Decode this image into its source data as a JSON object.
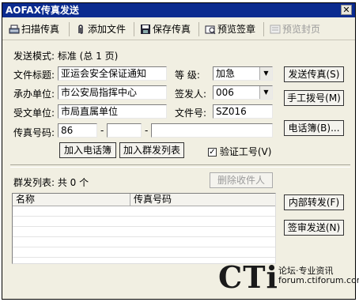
{
  "window": {
    "title": "AOFAX传真发送"
  },
  "toolbar": {
    "scan": "扫描传真",
    "attach": "添加文件",
    "save": "保存传真",
    "preview_sign": "预览签章",
    "preview_cover": "预览封页"
  },
  "form": {
    "send_mode": "发送模式: 标准 (总 1 页)",
    "title_label": "文件标题:",
    "title_value": "亚运会安全保证通知",
    "level_label": "等   级:",
    "level_value": "加急",
    "unit_label": "承办单位:",
    "unit_value": "市公安局指挥中心",
    "signer_label": "签发人:",
    "signer_value": "006",
    "recv_label": "受文单位:",
    "recv_value": "市局直属单位",
    "docno_label": "文件号:",
    "docno_value": "SZ016",
    "fax_label": "传真号码:",
    "fax_area": "86",
    "fax_dash1": "-",
    "fax_dash2": "-",
    "fax_mid": "",
    "fax_num": ""
  },
  "buttons": {
    "send": "发送传真(S)",
    "manual": "手工拨号(M)",
    "phonebook": "电话簿(B)...",
    "add_phonebook": "加入电话簿",
    "add_group": "加入群发列表",
    "verify_label": "验证工号(V)",
    "delete_recipient": "删除收件人",
    "forward": "内部转发(F)",
    "review_send": "签审发送(N)"
  },
  "group": {
    "label": "群发列表: 共 0 个",
    "col_name": "名称",
    "col_fax": "传真号码"
  },
  "watermark": {
    "brand": "CTi",
    "line1": "论坛·专业资讯",
    "line2": "forum.ctiforum.com"
  }
}
